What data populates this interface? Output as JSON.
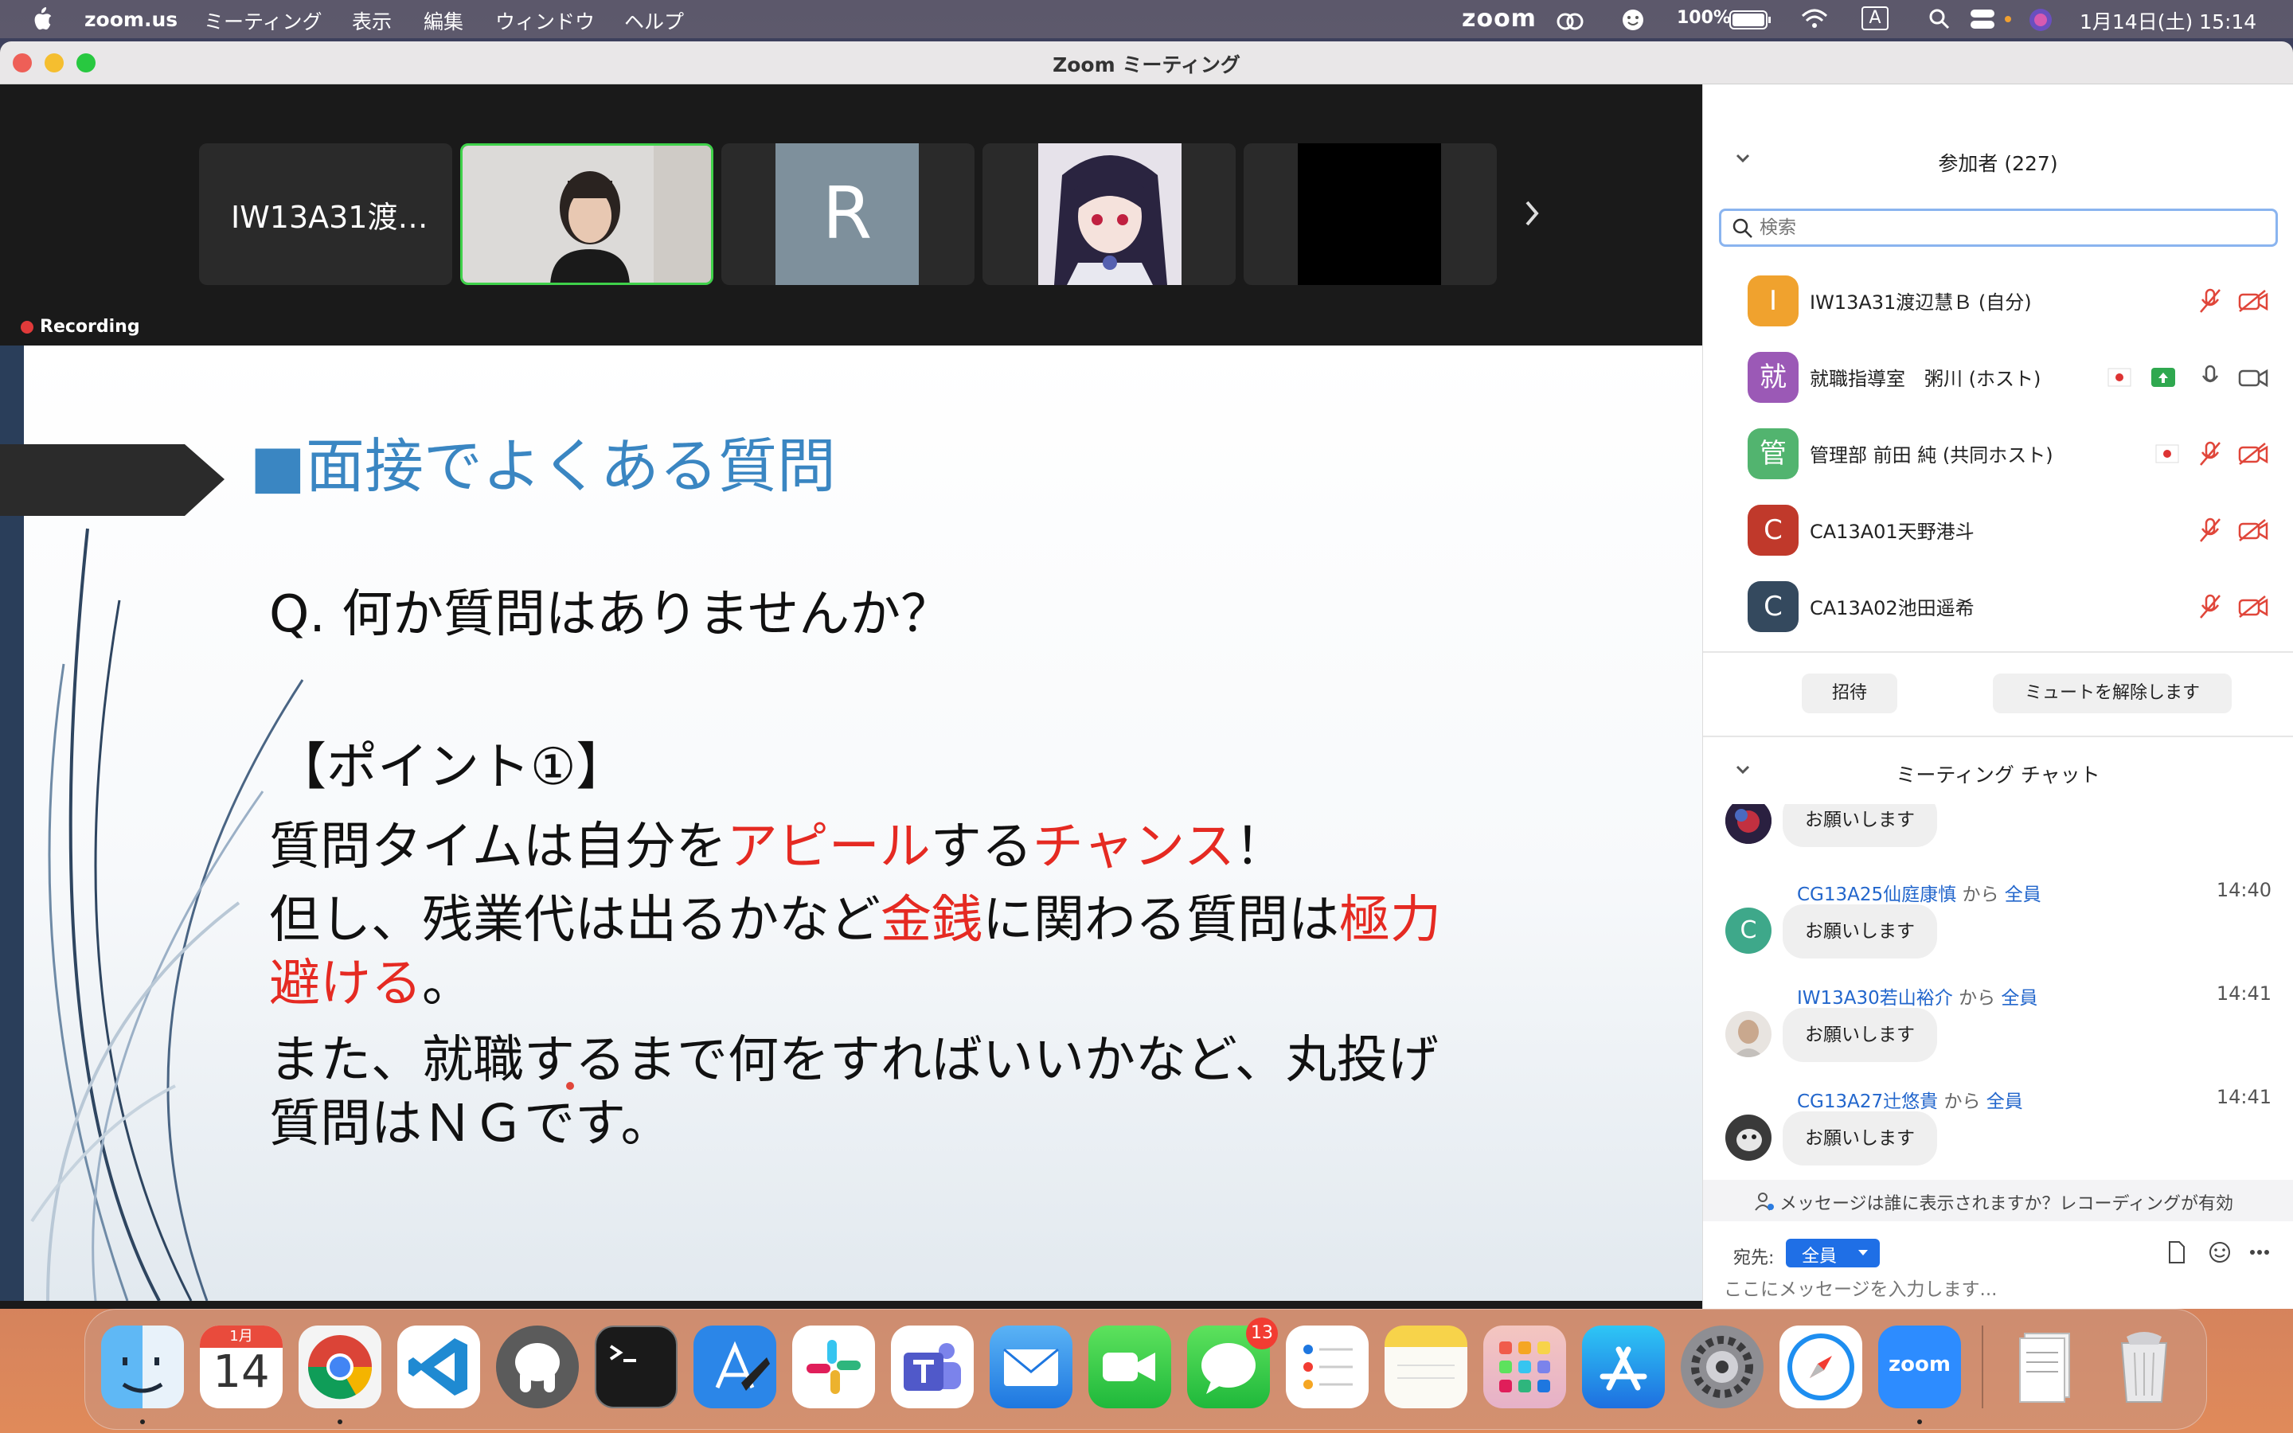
{
  "menubar": {
    "app": "zoom.us",
    "items": [
      "ミーティング",
      "表示",
      "編集",
      "ウィンドウ",
      "ヘルプ"
    ],
    "zoom_logo": "zoom",
    "battery": "100%",
    "input_source": "A",
    "datetime": "1月14日(土) 15:14"
  },
  "window": {
    "title": "Zoom ミーティング"
  },
  "video_strip": {
    "tile1_name": "IW13A31渡…",
    "tile3_letter": "R",
    "recording": "Recording"
  },
  "slide": {
    "heading": "■面接でよくある質問",
    "question": "Q. 何か質問はありませんか？",
    "point_label": "【ポイント①】",
    "line1": {
      "a": "質問タイムは自分を",
      "b": "アピール",
      "c": "する",
      "d": "チャンス",
      "e": "！"
    },
    "line2": {
      "a": "但し、残業代は出るかなど",
      "b": "金銭",
      "c": "に関わる質問は",
      "d": "極力"
    },
    "line3": {
      "a": "避ける",
      "b": "。"
    },
    "line4": "また、就職するまで何をすればいいかなど、丸投げ",
    "line5": "質問はＮＧです。"
  },
  "participants": {
    "header": "参加者 (227)",
    "search_placeholder": "検索",
    "list": [
      {
        "initial": "I",
        "name": "IW13A31渡辺慧Ｂ (自分)",
        "color": "#f0a22e"
      },
      {
        "initial": "就",
        "name": "就職指導室　粥川 (ホスト)",
        "color": "#9b59b6"
      },
      {
        "initial": "管",
        "name": "管理部 前田 純 (共同ホスト)",
        "color": "#52b46f"
      },
      {
        "initial": "C",
        "name": "CA13A01天野港斗",
        "color": "#c0392b"
      },
      {
        "initial": "C",
        "name": "CA13A02池田遥希",
        "color": "#34495e"
      }
    ],
    "invite": "招待",
    "unmute": "ミュートを解除します"
  },
  "chat": {
    "header": "ミーティング チャット",
    "messages": [
      {
        "sender": "",
        "from": "",
        "to": "",
        "time": "",
        "text": "お願いします"
      },
      {
        "sender": "CG13A25仙庭康慎",
        "from": "から",
        "to": "全員",
        "time": "14:40",
        "text": "お願いします",
        "initial": "C"
      },
      {
        "sender": "IW13A30若山裕介",
        "from": "から",
        "to": "全員",
        "time": "14:41",
        "text": "お願いします"
      },
      {
        "sender": "CG13A27辻悠貴",
        "from": "から",
        "to": "全員",
        "time": "14:41",
        "text": "お願いします"
      }
    ],
    "notice": "メッセージは誰に表示されますか？レコーディングが有効",
    "to_label": "宛先:",
    "to_value": "全員",
    "input_placeholder": "ここにメッセージを入力します..."
  },
  "dock": {
    "calendar_month": "1月",
    "calendar_day": "14",
    "messages_badge": "13",
    "zoom_label": "zoom"
  }
}
